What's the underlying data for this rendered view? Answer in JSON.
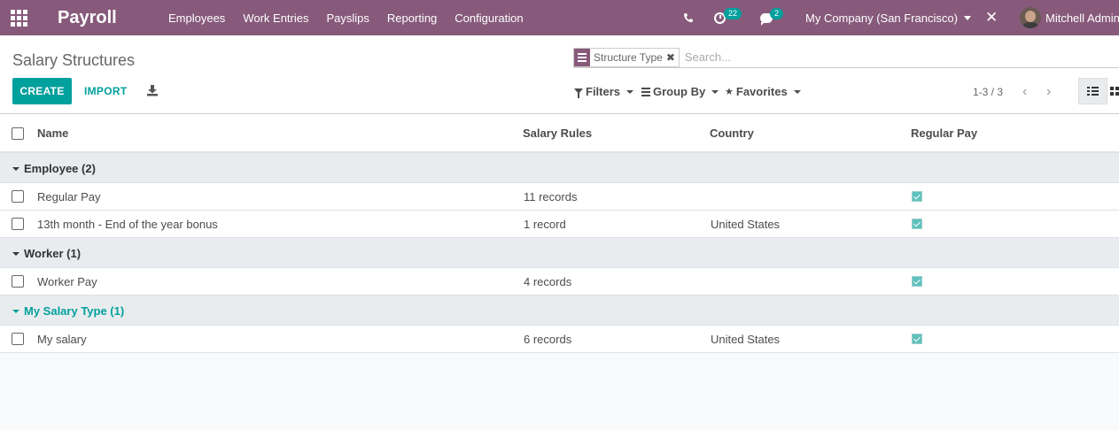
{
  "navbar": {
    "app_name": "Payroll",
    "menu": [
      "Employees",
      "Work Entries",
      "Payslips",
      "Reporting",
      "Configuration"
    ],
    "activity_count": "22",
    "message_count": "2",
    "company": "My Company (San Francisco)",
    "user": "Mitchell Admin"
  },
  "control_panel": {
    "title": "Salary Structures",
    "facet": "Structure Type",
    "search_placeholder": "Search...",
    "create_label": "CREATE",
    "import_label": "IMPORT",
    "filters_label": "Filters",
    "groupby_label": "Group By",
    "favorites_label": "Favorites",
    "pager": "1-3 / 3"
  },
  "table": {
    "columns": [
      "Name",
      "Salary Rules",
      "Country",
      "Regular Pay"
    ],
    "groups": [
      {
        "label": "Employee (2)",
        "rows": [
          {
            "name": "Regular Pay",
            "rules": "11 records",
            "country": "",
            "regular_pay": true
          },
          {
            "name": "13th month - End of the year bonus",
            "rules": "1 record",
            "country": "United States",
            "regular_pay": true
          }
        ]
      },
      {
        "label": "Worker (1)",
        "rows": [
          {
            "name": "Worker Pay",
            "rules": "4 records",
            "country": "",
            "regular_pay": true
          }
        ]
      },
      {
        "label": "My Salary Type (1)",
        "rows": [
          {
            "name": "My salary",
            "rules": "6 records",
            "country": "United States",
            "regular_pay": true
          }
        ]
      }
    ]
  },
  "colors": {
    "navbar": "#875a7b",
    "accent": "#00a09d",
    "group_background": "#e9ecef"
  }
}
